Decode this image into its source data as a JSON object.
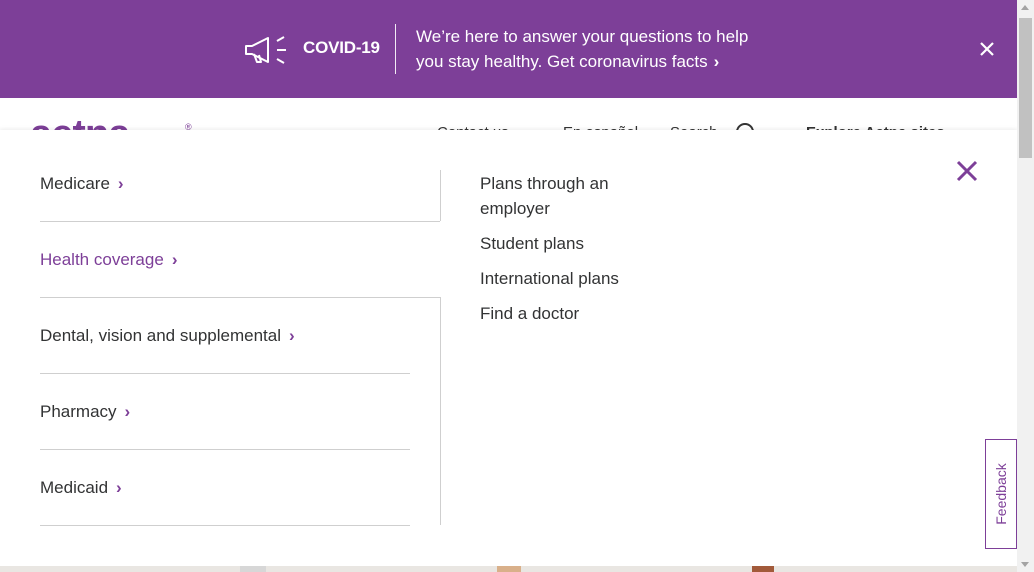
{
  "banner": {
    "title": "COVID-19",
    "message_line1": "We’re here to answer your questions to help",
    "message_line2": "you stay healthy. Get coronavirus facts",
    "chevron": "›",
    "icon": "megaphone-icon",
    "close_icon": "close-icon",
    "background": "#7d3f98"
  },
  "header": {
    "logo": "aetna",
    "logo_reg": "®",
    "nav_peek": [
      "Contact us",
      "En español",
      "Search",
      "Explore Aetna sites"
    ]
  },
  "menu": {
    "items": [
      {
        "label": "Medicare",
        "chevron": "›"
      },
      {
        "label": "Health coverage",
        "chevron": "›"
      },
      {
        "label": "Dental, vision and supplemental",
        "chevron": "›"
      },
      {
        "label": "Pharmacy",
        "chevron": "›"
      },
      {
        "label": "Medicaid",
        "chevron": "›"
      }
    ],
    "active_index": 1,
    "sublinks": [
      {
        "label": "Plans through an employer"
      },
      {
        "label": "Student plans"
      },
      {
        "label": "International plans"
      },
      {
        "label": "Find a doctor"
      }
    ],
    "close_icon": "close-icon"
  },
  "feedback": {
    "label": "Feedback"
  },
  "colors": {
    "brand": "#7d3f98",
    "text": "#323334",
    "divider": "#cfcfcf"
  }
}
